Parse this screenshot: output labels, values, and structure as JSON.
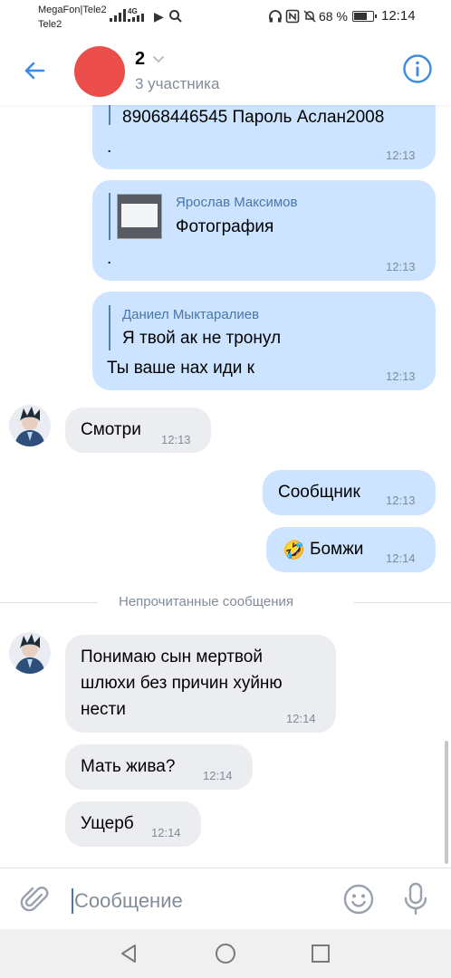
{
  "status_bar": {
    "carrier_line1": "MegaFon|Tele2",
    "carrier_line2": "Tele2",
    "network": "4G",
    "battery": "68 %",
    "time": "12:14"
  },
  "header": {
    "title": "2",
    "subtitle": "3 участника",
    "avatar_color": "#eb4d4b",
    "accent_color": "#3f8ae0"
  },
  "messages": [
    {
      "id": "m1",
      "direction": "out",
      "text": "89068446545 Пароль Аслан2008",
      "extra": ".",
      "time": "12:13"
    },
    {
      "id": "m2",
      "direction": "out",
      "quote_author": "Ярослав Максимов",
      "quote_text": "Фотография",
      "extra": ".",
      "time": "12:13"
    },
    {
      "id": "m3",
      "direction": "out",
      "quote_author": "Даниел Мыктаралиев",
      "quote_text": "Я твой ак не тронул",
      "text": "Ты ваше нах иди к",
      "time": "12:13"
    },
    {
      "id": "m4",
      "direction": "in",
      "text": "Смотри",
      "time": "12:13"
    },
    {
      "id": "m5",
      "direction": "out",
      "text": "Сообщник",
      "time": "12:13"
    },
    {
      "id": "m6",
      "direction": "out",
      "emoji": "🤣",
      "text": "Бомжи",
      "time": "12:14"
    },
    {
      "id": "m7",
      "direction": "in",
      "lines": [
        "Понимаю сын мертвой",
        "шлюхи без причин хуйню",
        "нести"
      ],
      "time": "12:14"
    },
    {
      "id": "m8",
      "direction": "in",
      "text": "Мать жива?",
      "time": "12:14"
    },
    {
      "id": "m9",
      "direction": "in",
      "text": "Ущерб",
      "time": "12:14"
    }
  ],
  "separator": "Непрочитанные сообщения",
  "composer": {
    "placeholder": "Сообщение"
  },
  "icons": {
    "back": "arrow-left",
    "info": "info-circle",
    "attach": "paperclip",
    "emoji": "smiley",
    "mic": "microphone",
    "nav": [
      "triangle-back",
      "circle-home",
      "square-recents"
    ]
  }
}
